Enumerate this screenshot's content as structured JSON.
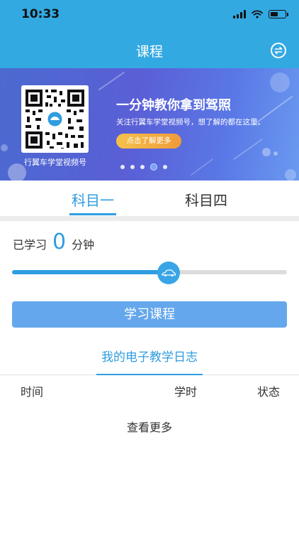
{
  "status_bar": {
    "time": "10:33"
  },
  "nav": {
    "title": "课程"
  },
  "banner": {
    "qr_label": "行翼车学堂视频号",
    "title": "一分钟教你拿到驾照",
    "subtitle": "关注行翼车学堂视频号，想了解的都在这里。",
    "cta_label": "点击了解更多",
    "slide_count": 5,
    "active_slide_index": 3
  },
  "subject_tabs": {
    "items": [
      {
        "label": "科目一",
        "active": true
      },
      {
        "label": "科目四",
        "active": false
      }
    ]
  },
  "study": {
    "prefix": "已学习",
    "minutes": "0",
    "suffix": "分钟",
    "progress_fraction": 0.57
  },
  "study_button_label": "学习课程",
  "log": {
    "title": "我的电子教学日志",
    "columns": [
      "时间",
      "学时",
      "状态"
    ],
    "more_label": "查看更多"
  },
  "colors": {
    "primary": "#33a9e2",
    "accent_blue": "#2f9de0",
    "button_blue": "#64a7ec"
  }
}
